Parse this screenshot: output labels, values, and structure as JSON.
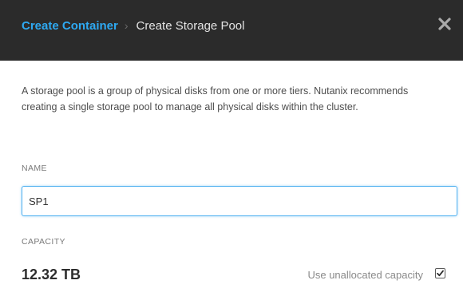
{
  "header": {
    "breadcrumb_parent": "Create Container",
    "breadcrumb_separator": "›",
    "breadcrumb_current": "Create Storage Pool",
    "close_icon": "close-icon"
  },
  "content": {
    "description": "A storage pool is a group of physical disks from one or more tiers. Nutanix recommends creating a single storage pool to manage all physical disks within the cluster.",
    "name_label": "NAME",
    "name_value": "SP1",
    "capacity_label": "CAPACITY",
    "capacity_value": "12.32 TB",
    "use_unallocated_label": "Use unallocated capacity",
    "use_unallocated_checked": true
  },
  "colors": {
    "header_bg": "#2b2b2b",
    "link": "#2ea9f2",
    "input_focus": "#4fb0f0"
  }
}
